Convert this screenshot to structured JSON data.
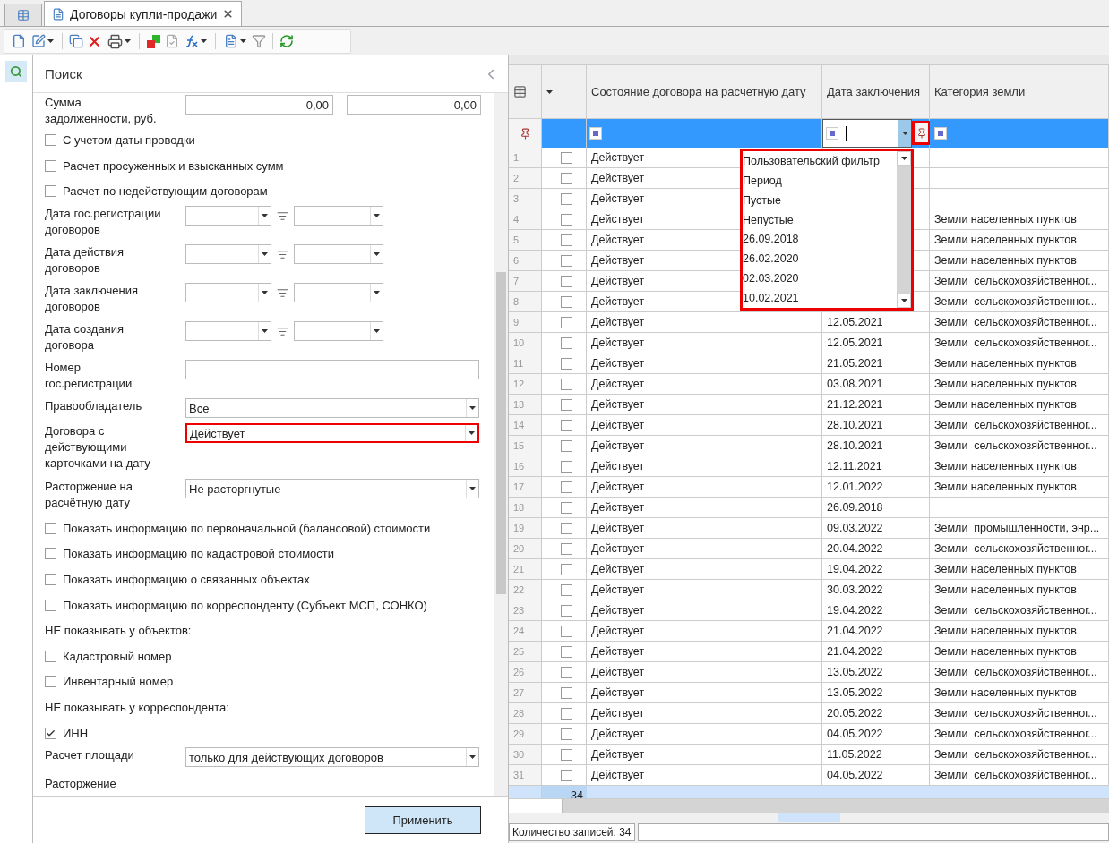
{
  "tabs": [
    {
      "kind": "icon",
      "selected": false
    },
    {
      "kind": "doc",
      "label": "Договоры купли-продажи",
      "selected": true
    }
  ],
  "search_panel": {
    "title": "Поиск",
    "fields": [
      {
        "kind": "range",
        "label": "Сумма задолженности, руб.",
        "from": "0,00",
        "to": "0,00"
      },
      {
        "kind": "checkbox",
        "label": "С учетом даты проводки",
        "checked": false
      },
      {
        "kind": "checkbox",
        "label": "Расчет просуженных и взысканных сумм",
        "checked": false
      },
      {
        "kind": "checkbox",
        "label": "Расчет по недействующим договорам",
        "checked": false
      },
      {
        "kind": "daterange",
        "label": "Дата гос.регистрации договоров"
      },
      {
        "kind": "daterange",
        "label": "Дата действия договоров"
      },
      {
        "kind": "daterange",
        "label": "Дата заключения договоров"
      },
      {
        "kind": "daterange",
        "label": "Дата создания договора"
      },
      {
        "kind": "text",
        "label": "Номер гос.регистрации"
      },
      {
        "kind": "select",
        "label": "Правообладатель",
        "value": "Все",
        "highlighted": false
      },
      {
        "kind": "select",
        "label": "Договора с действующими карточками на дату",
        "value": "Действует",
        "highlighted": true
      },
      {
        "kind": "select",
        "label": "Расторжение на расчётную дату",
        "value": "Не расторгнутые",
        "highlighted": false
      },
      {
        "kind": "checkbox",
        "label": "Показать информацию по первоначальной (балансовой) стоимости",
        "checked": false
      },
      {
        "kind": "checkbox",
        "label": "Показать информацию по кадастровой стоимости",
        "checked": false
      },
      {
        "kind": "checkbox",
        "label": "Показать информацию о связанных объектах",
        "checked": false
      },
      {
        "kind": "checkbox",
        "label": "Показать информацию по корреспонденту (Субъект МСП, СОНКО)",
        "checked": false
      },
      {
        "kind": "caption",
        "label": "НЕ показывать у объектов:"
      },
      {
        "kind": "checkbox",
        "label": "Кадастровый номер",
        "checked": false
      },
      {
        "kind": "checkbox",
        "label": "Инвентарный номер",
        "checked": false
      },
      {
        "kind": "caption",
        "label": "НЕ показывать у корреспондента:"
      },
      {
        "kind": "checkbox",
        "label": "ИНН",
        "checked": true
      },
      {
        "kind": "select",
        "label": "Расчет  площади",
        "value": "только для действующих договоров",
        "highlighted": false
      },
      {
        "kind": "caption",
        "label": "Расторжение"
      }
    ],
    "apply_button": "Применить"
  },
  "grid": {
    "columns": [
      "Состояние договора на расчетную дату",
      "Дата заключения",
      "Категория земли"
    ],
    "filter_button_highlighted": true,
    "rows": [
      {
        "n": "1",
        "checked": false,
        "state": "Действует",
        "date": "",
        "category": ""
      },
      {
        "n": "2",
        "checked": false,
        "state": "Действует",
        "date": "",
        "category": ""
      },
      {
        "n": "3",
        "checked": false,
        "state": "Действует",
        "date": "",
        "category": ""
      },
      {
        "n": "4",
        "checked": false,
        "state": "Действует",
        "date": "",
        "category": "Земли населенных пунктов"
      },
      {
        "n": "5",
        "checked": false,
        "state": "Действует",
        "date": "",
        "category": "Земли населенных пунктов"
      },
      {
        "n": "6",
        "checked": false,
        "state": "Действует",
        "date": "",
        "category": "Земли населенных пунктов"
      },
      {
        "n": "7",
        "checked": false,
        "state": "Действует",
        "date": "",
        "category": "Земли  сельскохозяйственног..."
      },
      {
        "n": "8",
        "checked": false,
        "state": "Действует",
        "date": "",
        "category": "Земли  сельскохозяйственног..."
      },
      {
        "n": "9",
        "checked": false,
        "state": "Действует",
        "date": "12.05.2021",
        "category": "Земли  сельскохозяйственног..."
      },
      {
        "n": "10",
        "checked": false,
        "state": "Действует",
        "date": "12.05.2021",
        "category": "Земли  сельскохозяйственног..."
      },
      {
        "n": "11",
        "checked": false,
        "state": "Действует",
        "date": "21.05.2021",
        "category": "Земли населенных пунктов"
      },
      {
        "n": "12",
        "checked": false,
        "state": "Действует",
        "date": "03.08.2021",
        "category": "Земли населенных пунктов"
      },
      {
        "n": "13",
        "checked": false,
        "state": "Действует",
        "date": "21.12.2021",
        "category": "Земли населенных пунктов"
      },
      {
        "n": "14",
        "checked": false,
        "state": "Действует",
        "date": "28.10.2021",
        "category": "Земли  сельскохозяйственног..."
      },
      {
        "n": "15",
        "checked": false,
        "state": "Действует",
        "date": "28.10.2021",
        "category": "Земли  сельскохозяйственног..."
      },
      {
        "n": "16",
        "checked": false,
        "state": "Действует",
        "date": "12.11.2021",
        "category": "Земли населенных пунктов"
      },
      {
        "n": "17",
        "checked": false,
        "state": "Действует",
        "date": "12.01.2022",
        "category": "Земли населенных пунктов"
      },
      {
        "n": "18",
        "checked": false,
        "state": "Действует",
        "date": "26.09.2018",
        "category": ""
      },
      {
        "n": "19",
        "checked": false,
        "state": "Действует",
        "date": "09.03.2022",
        "category": "Земли  промышленности, энр..."
      },
      {
        "n": "20",
        "checked": false,
        "state": "Действует",
        "date": "20.04.2022",
        "category": "Земли  сельскохозяйственног..."
      },
      {
        "n": "21",
        "checked": false,
        "state": "Действует",
        "date": "19.04.2022",
        "category": "Земли населенных пунктов"
      },
      {
        "n": "22",
        "checked": false,
        "state": "Действует",
        "date": "30.03.2022",
        "category": "Земли населенных пунктов"
      },
      {
        "n": "23",
        "checked": false,
        "state": "Действует",
        "date": "19.04.2022",
        "category": "Земли  сельскохозяйственног..."
      },
      {
        "n": "24",
        "checked": false,
        "state": "Действует",
        "date": "21.04.2022",
        "category": "Земли населенных пунктов"
      },
      {
        "n": "25",
        "checked": false,
        "state": "Действует",
        "date": "21.04.2022",
        "category": "Земли населенных пунктов"
      },
      {
        "n": "26",
        "checked": false,
        "state": "Действует",
        "date": "13.05.2022",
        "category": "Земли  сельскохозяйственног..."
      },
      {
        "n": "27",
        "checked": false,
        "state": "Действует",
        "date": "13.05.2022",
        "category": "Земли населенных пунктов"
      },
      {
        "n": "28",
        "checked": false,
        "state": "Действует",
        "date": "20.05.2022",
        "category": "Земли  сельскохозяйственног..."
      },
      {
        "n": "29",
        "checked": false,
        "state": "Действует",
        "date": "04.05.2022",
        "category": "Земли  сельскохозяйственног..."
      },
      {
        "n": "30",
        "checked": false,
        "state": "Действует",
        "date": "11.05.2022",
        "category": "Земли  сельскохозяйственног..."
      },
      {
        "n": "31",
        "checked": false,
        "state": "Действует",
        "date": "04.05.2022",
        "category": "Земли  сельскохозяйственног..."
      }
    ],
    "total": "34",
    "filter_dropdown": {
      "highlighted": true,
      "items": [
        "Пользовательский фильтр",
        "Период",
        "Пустые",
        "Непустые",
        "26.09.2018",
        "26.02.2020",
        "02.03.2020",
        "10.02.2021"
      ]
    }
  },
  "status_bar": {
    "count": "Количество записей: 34"
  }
}
